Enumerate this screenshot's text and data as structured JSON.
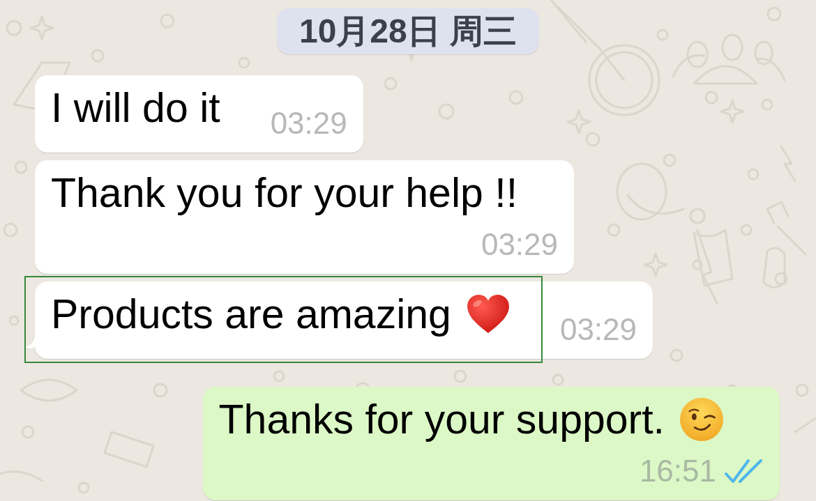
{
  "date_label": "10月28日 周三",
  "messages": [
    {
      "kind": "incoming",
      "text": "I will do it",
      "time": "03:29",
      "tail": false,
      "highlighted": false
    },
    {
      "kind": "incoming",
      "text": "Thank you for your help !!",
      "time": "03:29",
      "tail": false,
      "highlighted": false
    },
    {
      "kind": "incoming",
      "text": "Products are amazing",
      "emoji": {
        "kind": "heart"
      },
      "time": "03:29",
      "tail": true,
      "highlighted": true
    },
    {
      "kind": "outgoing",
      "text": "Thanks for your support.",
      "emoji": {
        "kind": "wink"
      },
      "time": "16:51",
      "read": true,
      "tail": false,
      "highlighted": false
    }
  ]
}
